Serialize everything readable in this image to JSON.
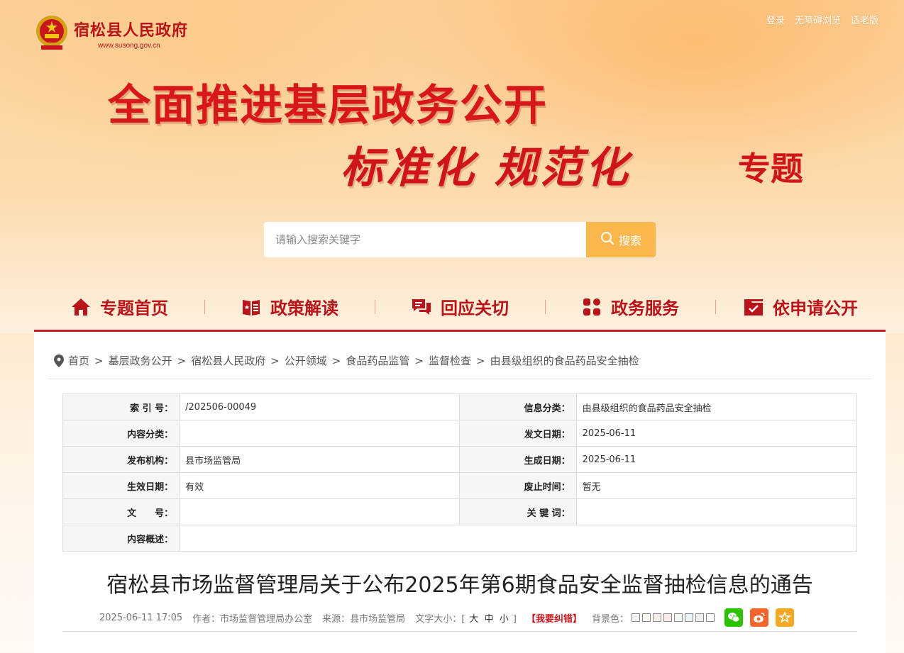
{
  "header": {
    "site_name": "宿松县人民政府",
    "site_url": "www.susong.gov.cn",
    "top_links": [
      "登录",
      "无障碍浏览",
      "适老版"
    ]
  },
  "banner": {
    "line1": "全面推进基层政务公开",
    "line2": "标准化 规范化",
    "line3": "专题"
  },
  "search": {
    "placeholder": "请输入搜索关键字",
    "button_label": "搜索"
  },
  "nav": [
    {
      "label": "专题首页",
      "icon": "home-icon"
    },
    {
      "label": "政策解读",
      "icon": "book-icon"
    },
    {
      "label": "回应关切",
      "icon": "chat-icon"
    },
    {
      "label": "政务服务",
      "icon": "grid-icon"
    },
    {
      "label": "依申请公开",
      "icon": "folder-check-icon"
    }
  ],
  "breadcrumb": [
    "首页",
    "基层政务公开",
    "宿松县人民政府",
    "公开领域",
    "食品药品监管",
    "监督检查",
    "由县级组织的食品药品安全抽检"
  ],
  "meta": {
    "rows": [
      {
        "l1": "索 引 号：",
        "v1": "/202506-00049",
        "l2": "信息分类：",
        "v2": "由县级组织的食品药品安全抽检"
      },
      {
        "l1": "内容分类：",
        "v1": "",
        "l2": "发文日期：",
        "v2": "2025-06-11"
      },
      {
        "l1": "发布机构：",
        "v1": "县市场监管局",
        "l2": "生成日期：",
        "v2": "2025-06-11"
      },
      {
        "l1": "生效日期：",
        "v1": "有效",
        "l2": "废止时间：",
        "v2": "暂无"
      },
      {
        "l1": "文　　号：",
        "v1": "",
        "l2": "关 键 词：",
        "v2": ""
      }
    ],
    "summary_label": "内容概述：",
    "summary_value": ""
  },
  "article": {
    "title": "宿松县市场监督管理局关于公布2025年第6期食品安全监督抽检信息的通告",
    "datetime": "2025-06-11 17:05",
    "author": "作者：市场监督管理局办公室",
    "source": "来源：县市场监管局",
    "font_size_label": "文字大小：[",
    "font_sizes": [
      "大",
      "中",
      "小"
    ],
    "font_size_close": "]",
    "report_error": "【我要纠错】",
    "bg_color_label": "背景色：",
    "bg_colors": [
      "#f4f4f4",
      "#fafaf0",
      "#f8f0e8",
      "#fbe8e8",
      "#eef8ee",
      "#e8f4f8",
      "#eeeeee",
      "#ffffff"
    ],
    "share": [
      {
        "icon": "wechat-icon",
        "color": "#2dc100"
      },
      {
        "icon": "weibo-icon",
        "color": "#f5642a"
      },
      {
        "icon": "favorite-icon",
        "color": "#f5a623"
      }
    ]
  }
}
